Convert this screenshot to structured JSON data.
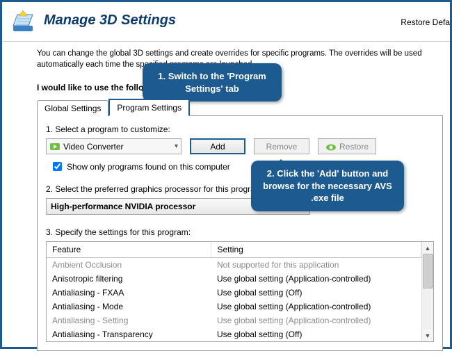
{
  "header": {
    "title": "Manage 3D Settings",
    "restore": "Restore Defa"
  },
  "description": "You can change the global 3D settings and create overrides for specific programs. The overrides will be used automatically each time the specified programs are launched.",
  "subheading": "I would like to use the following 3D settings:",
  "tabs": {
    "global": "Global Settings",
    "program": "Program Settings"
  },
  "step1": {
    "label": "1. Select a program to customize:",
    "selected": "Video Converter",
    "add": "Add",
    "remove": "Remove",
    "restore": "Restore",
    "checkbox": "Show only programs found on this computer"
  },
  "step2": {
    "label": "2. Select the preferred graphics processor for this program:",
    "selected": "High-performance NVIDIA processor"
  },
  "step3": {
    "label": "3. Specify the settings for this program:",
    "col_feature": "Feature",
    "col_setting": "Setting",
    "rows": [
      {
        "feature": "Ambient Occlusion",
        "setting": "Not supported for this application",
        "muted": true
      },
      {
        "feature": "Anisotropic filtering",
        "setting": "Use global setting (Application-controlled)"
      },
      {
        "feature": "Antialiasing - FXAA",
        "setting": "Use global setting (Off)"
      },
      {
        "feature": "Antialiasing - Mode",
        "setting": "Use global setting (Application-controlled)"
      },
      {
        "feature": "Antialiasing - Setting",
        "setting": "Use global setting (Application-controlled)",
        "muted": true
      },
      {
        "feature": "Antialiasing - Transparency",
        "setting": "Use global setting (Off)"
      }
    ]
  },
  "callouts": {
    "c1": "1. Switch to the 'Program Settings' tab",
    "c2": "2. Click the 'Add' button and browse for the necessary AVS .exe file"
  }
}
